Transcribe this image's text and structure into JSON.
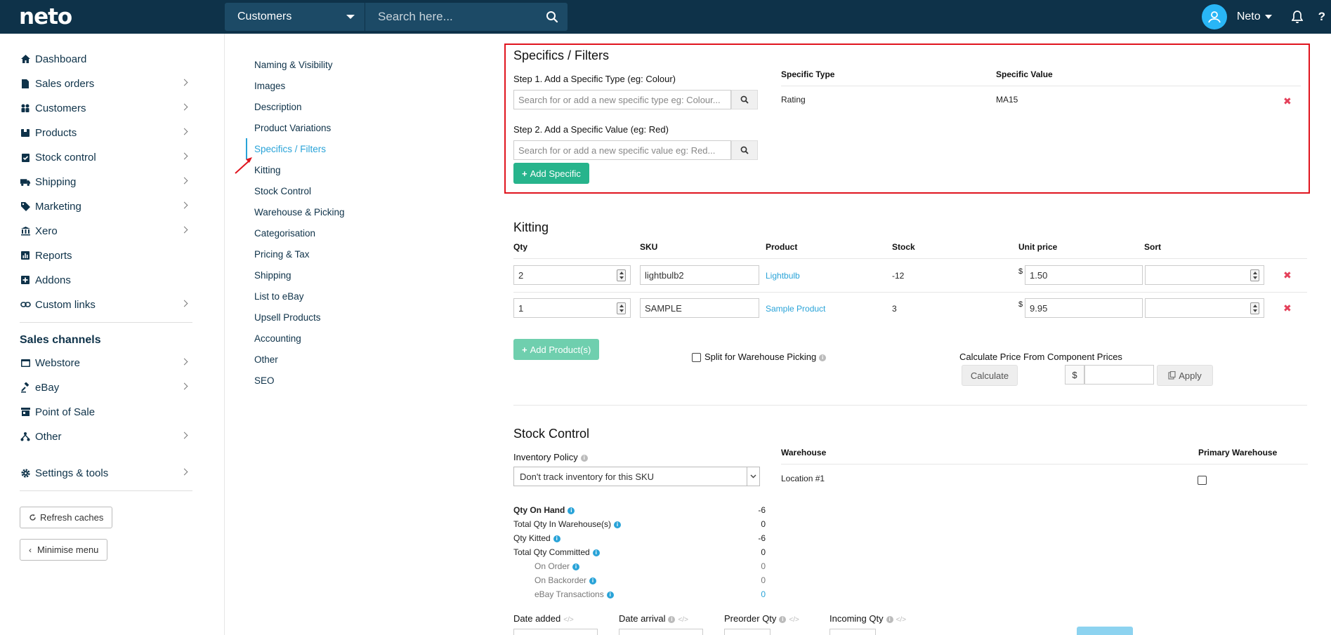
{
  "app": {
    "logo": "neto"
  },
  "topbar": {
    "search_scope": "Customers",
    "search_placeholder": "Search here...",
    "user_name": "Neto",
    "help": "?"
  },
  "sidebar": {
    "items": [
      {
        "label": "Dashboard",
        "icon": "home-icon",
        "chevron": false
      },
      {
        "label": "Sales orders",
        "icon": "document-icon",
        "chevron": true
      },
      {
        "label": "Customers",
        "icon": "users-icon",
        "chevron": true
      },
      {
        "label": "Products",
        "icon": "box-icon",
        "chevron": true
      },
      {
        "label": "Stock control",
        "icon": "clipboard-check-icon",
        "chevron": true
      },
      {
        "label": "Shipping",
        "icon": "truck-icon",
        "chevron": true
      },
      {
        "label": "Marketing",
        "icon": "tag-icon",
        "chevron": true
      },
      {
        "label": "Xero",
        "icon": "bank-icon",
        "chevron": true
      },
      {
        "label": "Reports",
        "icon": "bar-chart-icon",
        "chevron": false
      },
      {
        "label": "Addons",
        "icon": "plus-square-icon",
        "chevron": false
      },
      {
        "label": "Custom links",
        "icon": "link-icon",
        "chevron": true
      }
    ],
    "channels_heading": "Sales channels",
    "channels": [
      {
        "label": "Webstore",
        "icon": "window-icon",
        "chevron": true
      },
      {
        "label": "eBay",
        "icon": "gavel-icon",
        "chevron": true
      },
      {
        "label": "Point of Sale",
        "icon": "store-icon",
        "chevron": false
      },
      {
        "label": "Other",
        "icon": "sitemap-icon",
        "chevron": true
      }
    ],
    "settings": {
      "label": "Settings & tools",
      "icon": "gear-icon"
    },
    "refresh_label": "Refresh caches",
    "minimise_label": "Minimise menu"
  },
  "subnav": {
    "items": [
      "Naming & Visibility",
      "Images",
      "Description",
      "Product Variations",
      "Specifics / Filters",
      "Kitting",
      "Stock Control",
      "Warehouse & Picking",
      "Categorisation",
      "Pricing & Tax",
      "Shipping",
      "List to eBay",
      "Upsell Products",
      "Accounting",
      "Other",
      "SEO"
    ],
    "active_index": 4
  },
  "specifics": {
    "title": "Specifics / Filters",
    "step1_label": "Step 1. Add a Specific Type (eg: Colour)",
    "step1_placeholder": "Search for or add a new specific type eg: Colour...",
    "step2_label": "Step 2. Add a Specific Value (eg: Red)",
    "step2_placeholder": "Search for or add a new specific value eg: Red...",
    "add_button": "Add Specific",
    "col_type": "Specific Type",
    "col_value": "Specific Value",
    "rows": [
      {
        "type": "Rating",
        "value": "MA15"
      }
    ]
  },
  "kitting": {
    "title": "Kitting",
    "headers": [
      "Qty",
      "SKU",
      "Product",
      "Stock",
      "Unit price",
      "Sort"
    ],
    "rows": [
      {
        "qty": "2",
        "sku": "lightbulb2",
        "product": "Lightbulb",
        "stock": "-12",
        "currency": "$",
        "price": "1.50",
        "sort": ""
      },
      {
        "qty": "1",
        "sku": "SAMPLE",
        "product": "Sample Product",
        "stock": "3",
        "currency": "$",
        "price": "9.95",
        "sort": ""
      }
    ],
    "add_products": "Add Product(s)",
    "split_label": "Split for Warehouse Picking",
    "calc_heading": "Calculate Price From Component Prices",
    "calculate": "Calculate",
    "currency": "$",
    "apply": "Apply"
  },
  "stock": {
    "title": "Stock Control",
    "inventory_policy_label": "Inventory Policy",
    "inventory_policy_value": "Don't track inventory for this SKU",
    "warehouse_header": "Warehouse",
    "primary_header": "Primary Warehouse",
    "warehouse_row": "Location #1",
    "qty_on_hand_label": "Qty On Hand",
    "qty_on_hand": "-6",
    "total_in_wh_label": "Total Qty In Warehouse(s)",
    "total_in_wh": "0",
    "qty_kitted_label": "Qty Kitted",
    "qty_kitted": "-6",
    "total_committed_label": "Total Qty Committed",
    "total_committed": "0",
    "on_order_label": "On Order",
    "on_order": "0",
    "on_backorder_label": "On Backorder",
    "on_backorder": "0",
    "ebay_tx_label": "eBay Transactions",
    "ebay_tx": "0",
    "date_added": "Date added",
    "date_arrival": "Date arrival",
    "preorder_qty": "Preorder Qty",
    "incoming_qty": "Incoming Qty"
  },
  "colors": {
    "topbar": "#0e3249",
    "accent": "#29a3d8",
    "green": "#27b48c",
    "highlight": "#e0141e"
  }
}
